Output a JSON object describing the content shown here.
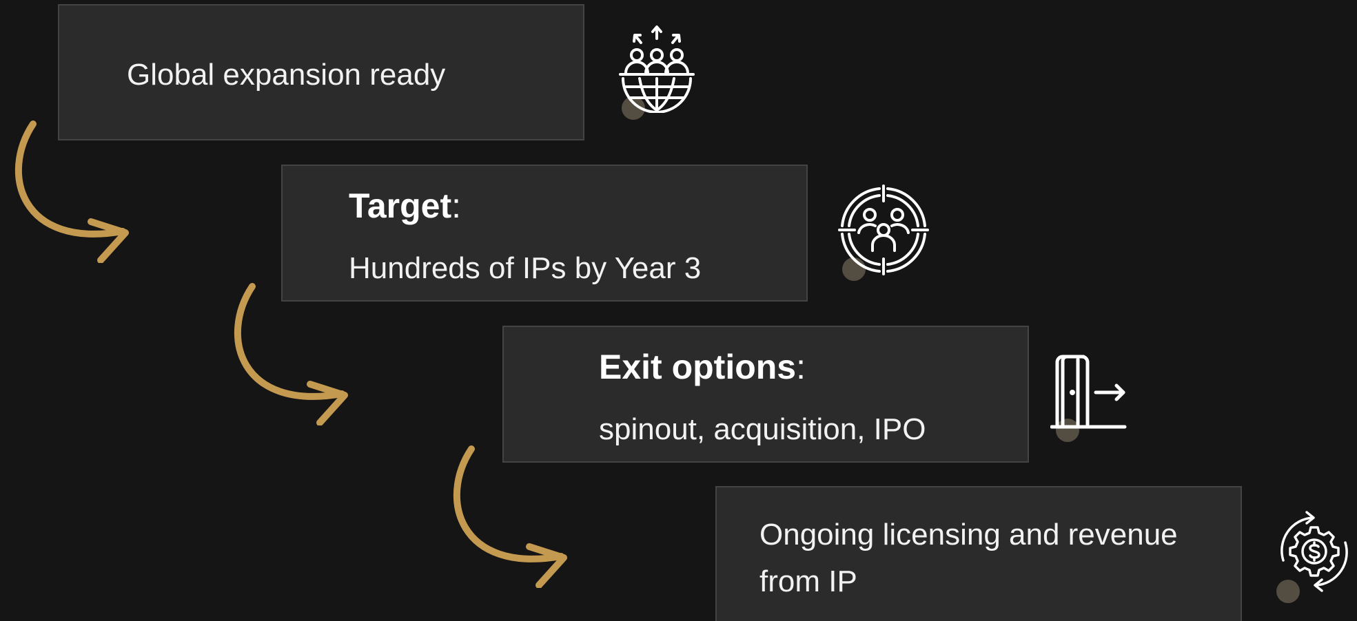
{
  "colors": {
    "background": "#151515",
    "card": "#2b2b2b",
    "card_border": "#444444",
    "arrow": "#c49a50",
    "text": "#f2f2f2"
  },
  "steps": [
    {
      "text": "Global expansion ready",
      "icon": "global-team-expansion-icon"
    },
    {
      "title": "Target",
      "title_suffix": ":",
      "text": "Hundreds of IPs by Year 3",
      "icon": "target-team-icon"
    },
    {
      "title": "Exit options",
      "title_suffix": ":",
      "text": "spinout, acquisition, IPO",
      "icon": "door-exit-icon"
    },
    {
      "text_line1": "Ongoing licensing and revenue",
      "text_line2": "from IP",
      "icon": "gear-dollar-cycle-icon"
    }
  ]
}
